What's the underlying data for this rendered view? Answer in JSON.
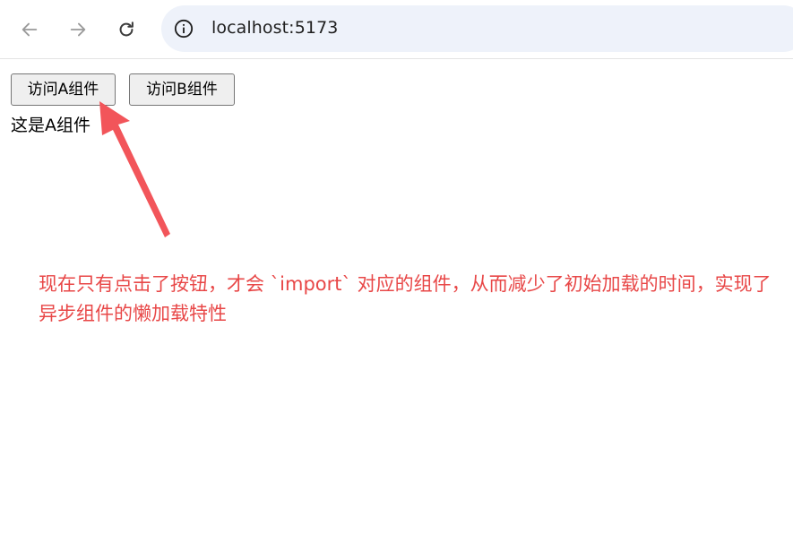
{
  "browser": {
    "url": "localhost:5173",
    "back_icon": "arrow-left-icon",
    "forward_icon": "arrow-right-icon",
    "reload_icon": "reload-icon",
    "site_info_icon": "info-icon"
  },
  "page": {
    "button_a_label": "访问A组件",
    "button_b_label": "访问B组件",
    "component_text": "这是A组件"
  },
  "annotation": {
    "text": "现在只有点击了按钮，才会 `import` 对应的组件，从而减少了初始加载的时间，实现了异步组件的懒加载特性",
    "color": "#e84747"
  }
}
